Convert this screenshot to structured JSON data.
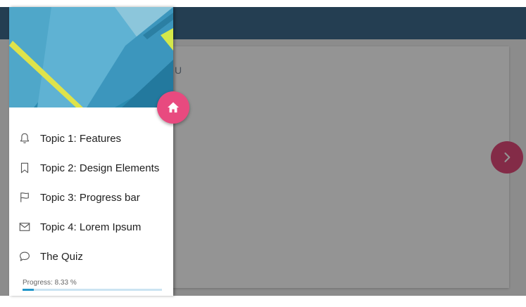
{
  "colors": {
    "accent": "#e84a7f",
    "app_bar": "#3f6c8e",
    "progress": "#2196c9"
  },
  "drawer": {
    "nav_items": [
      {
        "icon": "bell-icon",
        "label": "Topic 1: Features"
      },
      {
        "icon": "bookmark-icon",
        "label": "Topic 2: Design Elements"
      },
      {
        "icon": "flag-icon",
        "label": "Topic 3: Progress bar"
      },
      {
        "icon": "mail-icon",
        "label": "Topic 4: Lorem Ipsum"
      },
      {
        "icon": "chat-bubble-icon",
        "label": "The Quiz"
      }
    ],
    "progress": {
      "label": "Progress: 8.33 %",
      "percent": 8.33
    }
  },
  "fab": {
    "icon": "home-icon"
  },
  "main": {
    "next_icon": "chevron-right-icon",
    "partial_glyph": "U"
  }
}
